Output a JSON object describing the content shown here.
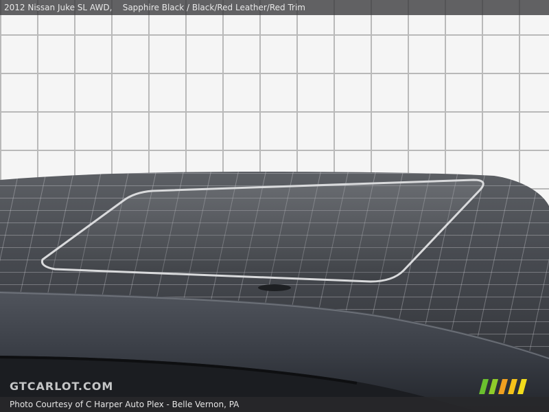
{
  "header": {
    "car": "2012 Nissan Juke SL AWD,",
    "color": "Sapphire Black",
    "separator": " / ",
    "interior": "Black/Red Leather/Red Trim"
  },
  "watermark": {
    "text": "GTCARLOT.COM"
  },
  "footer": {
    "credit": "Photo Courtesy of C Harper Auto Plex - Belle Vernon, PA"
  },
  "logo": {
    "icon": "gtcarlot-stripes-logo",
    "colors": [
      "#6abf2e",
      "#8fcd2a",
      "#f0a020",
      "#f5c21a",
      "#f2dc1c"
    ]
  },
  "scene": {
    "wall_color": "#f4f4f4",
    "grout_color": "#b8b8b8",
    "car_roof_color": "#3a3d42"
  }
}
